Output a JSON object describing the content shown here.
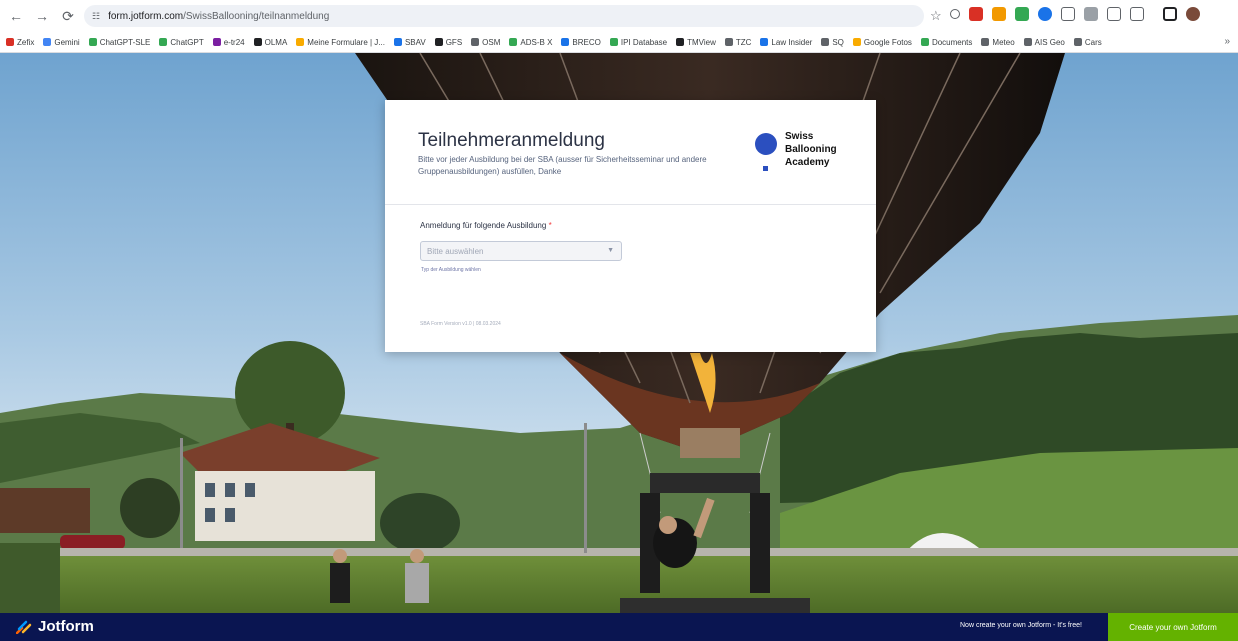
{
  "browser": {
    "url_host": "form.jotform.com",
    "url_path": "/SwissBallooning/teilnanmeldung",
    "bookmarks": [
      "Zefix",
      "Gemini",
      "ChatGPT-SLE",
      "ChatGPT",
      "e-tr24",
      "OLMA",
      "Meine Formulare | J...",
      "SBAV",
      "GFS",
      "OSM",
      "ADS-B X",
      "BRECO",
      "IPI Database",
      "TMView",
      "TZC",
      "Law Insider",
      "SQ",
      "Google Fotos",
      "Documents",
      "Meteo",
      "AIS Geo",
      "Cars"
    ],
    "bookmark_colors": [
      "#d93025",
      "#4285f4",
      "#34a853",
      "#34a853",
      "#7b1fa2",
      "#202124",
      "#f9ab00",
      "#1a73e8",
      "#202124",
      "#5f6368",
      "#34a853",
      "#1a73e8",
      "#34a853",
      "#202124",
      "#5f6368",
      "#1a73e8",
      "#5f6368",
      "#f9ab00",
      "#34a853",
      "#5f6368",
      "#5f6368",
      "#5f6368"
    ]
  },
  "form": {
    "title": "Teilnehmeranmeldung",
    "subtitle": "Bitte vor jeder Ausbildung bei der SBA (ausser für Sicherheitsseminar und andere Gruppenausbildungen) ausfüllen, Danke",
    "logo_lines": [
      "Swiss",
      "Ballooning",
      "Academy"
    ],
    "question_label": "Anmeldung für folgende Ausbildung",
    "required_mark": "*",
    "select_placeholder": "Bitte auswählen",
    "sublabel": "Typ der Ausbildung wählen",
    "version": "SBA Form Version v1.0 | 08.03.2024"
  },
  "footer": {
    "brand": "Jotform",
    "promo": "Now create your own Jotform - It's free!",
    "cta": "Create your own Jotform"
  },
  "colors": {
    "accent": "#2b4fbf",
    "jotform_navy": "#0a1551",
    "jotform_green": "#64b200"
  }
}
